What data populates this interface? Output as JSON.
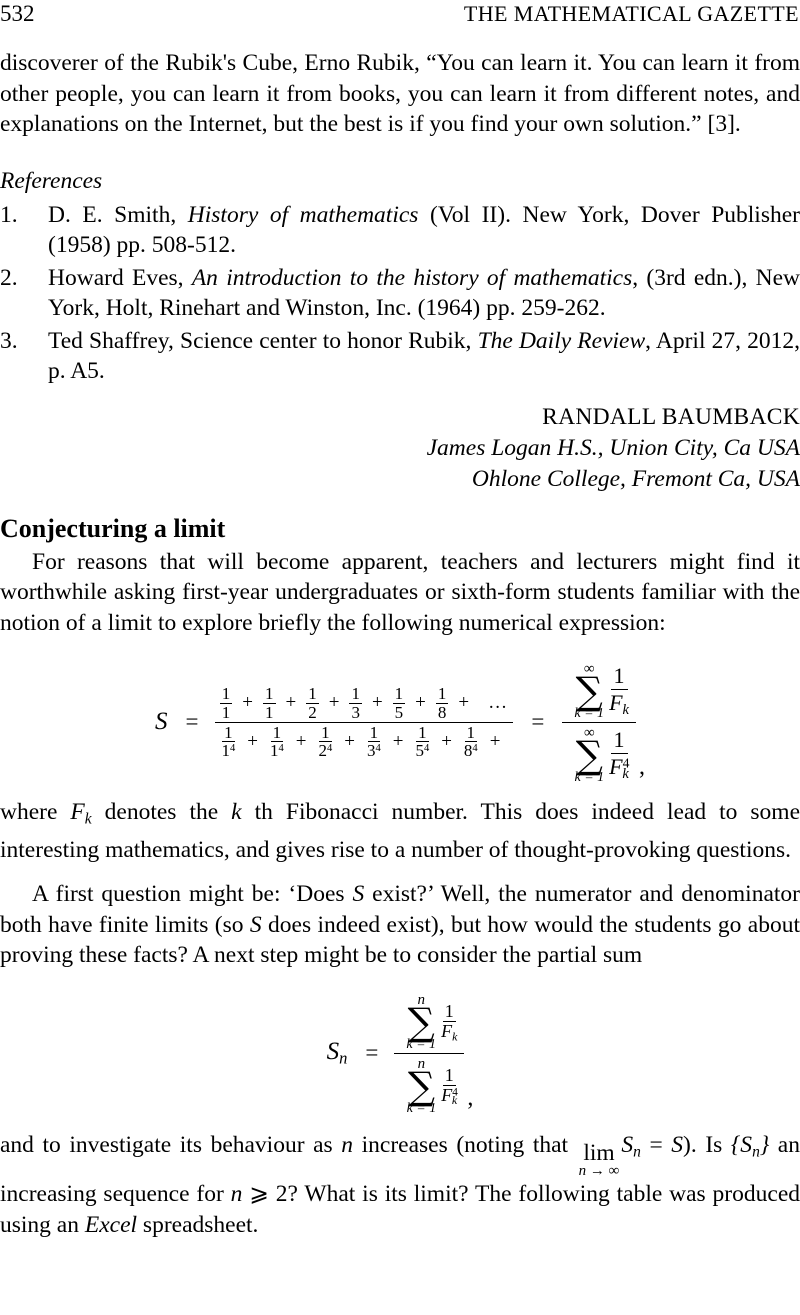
{
  "header": {
    "folio": "532",
    "journal_title": "THE MATHEMATICAL GAZETTE"
  },
  "quote_paragraph": "discoverer of the Rubik's Cube, Erno Rubik, “You can learn it.  You can learn it from other people, you can learn it from books, you can learn it from different notes, and explanations on the Internet, but the best is if you find your own solution.” [3].",
  "references": {
    "heading": "References",
    "items": [
      {
        "number": "1.",
        "part1": "D. E. Smith, ",
        "italic1": "History of mathematics",
        "part2": " (Vol II). New York, Dover Publisher (1958) pp. 508-512."
      },
      {
        "number": "2.",
        "part1": "Howard Eves, ",
        "italic1": "An introduction to the history of mathematics",
        "part2": ", (3rd edn.), New York, Holt, Rinehart and Winston, Inc. (1964) pp. 259-262."
      },
      {
        "number": "3.",
        "part1": "Ted Shaffrey, Science center to honor Rubik, ",
        "italic1": "The Daily Review",
        "part2": ", April 27, 2012, p. A5."
      }
    ]
  },
  "signature": {
    "author": "RANDALL BAUMBACK",
    "affiliation_1": "James Logan H.S., Union City, Ca USA",
    "affiliation_2": "Ohlone College, Fremont Ca, USA"
  },
  "article": {
    "heading": "Conjecturing a limit",
    "para_1": "For reasons that will become apparent, teachers and lecturers might find it worthwhile asking first-year undergraduates or sixth-form students familiar with the notion of a limit to explore briefly the following numerical expression:",
    "para_2_before": "where ",
    "para_2_symbol": "F",
    "para_2_symbol_sub": "k",
    "para_2_after": " denotes the ",
    "para_2_k": "k",
    "para_2_tail": " th Fibonacci number.  This does indeed lead to some interesting mathematics, and gives rise to a number of thought-provoking questions.",
    "para_3_a": "A first question might be: ‘Does ",
    "para_3_S1": "S",
    "para_3_b": " exist?’  Well, the numerator and denominator both have finite limits (so ",
    "para_3_S2": "S",
    "para_3_c": " does indeed exist), but how would the students go about proving these facts?  A next step might be to consider the partial sum",
    "para_4_a": "and to investigate its behaviour as ",
    "para_4_n": "n",
    "para_4_b": " increases (noting that ",
    "lim_word": "lim",
    "lim_under": "n → ∞",
    "para_4_Sn": "S",
    "para_4_Sn_sub": "n",
    "para_4_eq": " = ",
    "para_4_S": "S",
    "para_4_c": ").  Is ",
    "para_4_set": "{S",
    "para_4_set_sub": "n",
    "para_4_set_close": "}",
    "para_4_d": " an increasing sequence for ",
    "para_4_n2": "n",
    "para_4_ge": " ⩾ 2?  What is its limit?  The following table was produced using an ",
    "para_4_excel": "Excel",
    "para_4_e": " spreadsheet."
  },
  "equation_1": {
    "lhs": "S",
    "equals_1": "=",
    "equals_2": "=",
    "numerator_terms": [
      {
        "top": "1",
        "bottom": "1"
      },
      {
        "top": "1",
        "bottom": "1"
      },
      {
        "top": "1",
        "bottom": "2"
      },
      {
        "top": "1",
        "bottom": "3"
      },
      {
        "top": "1",
        "bottom": "5"
      },
      {
        "top": "1",
        "bottom": "8"
      }
    ],
    "numerator_plus": "+",
    "numerator_tail": "…",
    "denominator_terms": [
      {
        "top": "1",
        "bottom": "1",
        "bottom_exp": "4"
      },
      {
        "top": "1",
        "bottom": "1",
        "bottom_exp": "4"
      },
      {
        "top": "1",
        "bottom": "2",
        "bottom_exp": "4"
      },
      {
        "top": "1",
        "bottom": "3",
        "bottom_exp": "4"
      },
      {
        "top": "1",
        "bottom": "5",
        "bottom_exp": "4"
      },
      {
        "top": "1",
        "bottom": "8",
        "bottom_exp": "4"
      }
    ],
    "denominator_plus": "+",
    "rhs": {
      "num_sum_top": "∞",
      "num_sum_bottom": "k = 1",
      "num_term_top": "1",
      "num_term_bottom": "F",
      "num_term_sub": "k",
      "den_sum_top": "∞",
      "den_sum_bottom": "k = 1",
      "den_term_top": "1",
      "den_term_bottom": "F",
      "den_term_sub": "k",
      "den_term_exp": "4"
    },
    "trailing_comma": ","
  },
  "equation_2": {
    "lhs": "S",
    "lhs_sub": "n",
    "equals": "=",
    "num_sum_top": "n",
    "num_sum_bottom": "k = 1",
    "num_term_top": "1",
    "num_term_bottom": "F",
    "num_term_sub": "k",
    "den_sum_top": "n",
    "den_sum_bottom": "k = 1",
    "den_term_top": "1",
    "den_term_bottom": "F",
    "den_term_sub": "k",
    "den_term_exp": "4",
    "trailing_comma": ","
  }
}
